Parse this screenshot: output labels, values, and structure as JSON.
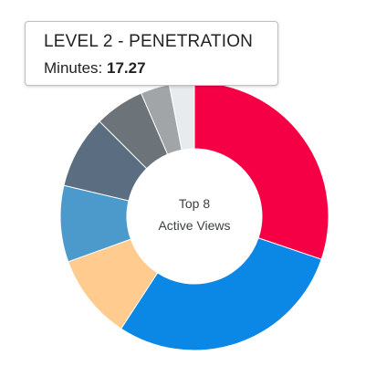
{
  "chart_data": {
    "type": "pie",
    "center_label": [
      "Top 8",
      "Active Views"
    ],
    "series": [
      {
        "values": [
          30.2,
          29.0,
          10.3,
          9.2,
          8.8,
          6.0,
          3.5,
          3.0
        ],
        "colors": [
          "#f50045",
          "#0b87e5",
          "#ffcb8e",
          "#4b9acb",
          "#5b6d80",
          "#6d7479",
          "#a2a5a8",
          "#e8ebee"
        ]
      }
    ]
  },
  "tooltip": {
    "title": "LEVEL 2 - PENETRATION",
    "metric_label": "Minutes:",
    "metric_value": "17.27"
  }
}
